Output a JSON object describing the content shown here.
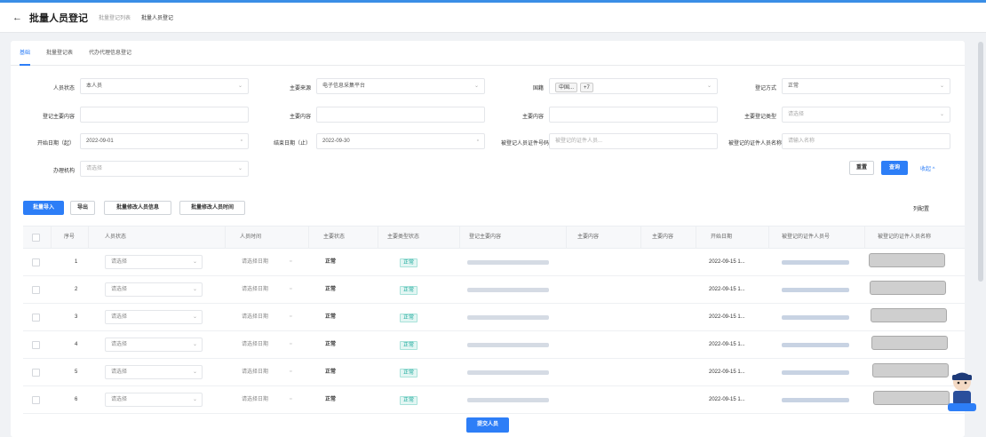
{
  "header": {
    "back_icon": "arrow-left-icon",
    "title": "批量人员登记",
    "breadcrumbs": [
      "批量登记列表",
      "批量人员登记"
    ]
  },
  "tabs": [
    {
      "label": "基础",
      "active": true
    },
    {
      "label": "批量登记表",
      "active": false
    },
    {
      "label": "代办代理信息登记",
      "active": false
    }
  ],
  "form": {
    "f1": {
      "label": "人员状态",
      "value": "本人员",
      "icon": "caret-down-icon"
    },
    "f2": {
      "label": "主要来源",
      "value": "电子信息采集平台",
      "icon": "caret-down-icon"
    },
    "f3": {
      "label": "国籍",
      "chips": [
        "中国...",
        "+7"
      ],
      "icon": "caret-down-icon"
    },
    "f4": {
      "label": "登记方式",
      "value": "正常",
      "icon": "caret-down-icon"
    },
    "f5": {
      "label": "登记主要内容",
      "value": ""
    },
    "f6": {
      "label": "主要内容",
      "value": ""
    },
    "f7": {
      "label": "主要内容",
      "value": ""
    },
    "f8": {
      "label": "主要登记类型",
      "value": "请选择",
      "icon": "caret-down-icon"
    },
    "f9": {
      "label": "开始日期（起）",
      "value": "2022-09-01",
      "icon": "calendar-icon"
    },
    "f10": {
      "label": "结束日期（止）",
      "value": "2022-09-30",
      "icon": "calendar-icon"
    },
    "f11": {
      "label": "被登记人员证件号码",
      "value": "被登记的证件人员..."
    },
    "f12": {
      "label": "被登记的证件人员名称",
      "value": "请输入名称"
    },
    "f13": {
      "label": "办理机构",
      "value": "请选择",
      "icon": "caret-down-icon"
    }
  },
  "filter_actions": {
    "reset": "重置",
    "search": "查询",
    "collapse": "收起 ^"
  },
  "toolbar": {
    "batch_import": "批量导入",
    "export": "导出",
    "batch_edit_person": "批量修改人员信息",
    "batch_edit_time": "批量修改人员时间",
    "column_settings": "列配置"
  },
  "table": {
    "headers": [
      "序号",
      "人员状态",
      "人员时间",
      "主要状态",
      "主要类型状态",
      "登记主要内容",
      "主要内容",
      "主要内容",
      "开始日期",
      "被登记的证件人员号",
      "被登记的证件人员名称"
    ],
    "rows": [
      {
        "no": "1",
        "state": "请选择",
        "time": "请选择日期",
        "status": "正常",
        "tag": "正常",
        "date": "2022-09-15 1..."
      },
      {
        "no": "2",
        "state": "请选择",
        "time": "请选择日期",
        "status": "正常",
        "tag": "正常",
        "date": "2022-09-15 1..."
      },
      {
        "no": "3",
        "state": "请选择",
        "time": "请选择日期",
        "status": "正常",
        "tag": "正常",
        "date": "2022-09-15 1..."
      },
      {
        "no": "4",
        "state": "请选择",
        "time": "请选择日期",
        "status": "正常",
        "tag": "正常",
        "date": "2022-09-15 1..."
      },
      {
        "no": "5",
        "state": "请选择",
        "time": "请选择日期",
        "status": "正常",
        "tag": "正常",
        "date": "2022-09-15 1..."
      },
      {
        "no": "6",
        "state": "请选择",
        "time": "请选择日期",
        "status": "正常",
        "tag": "正常",
        "date": "2022-09-15 1..."
      }
    ]
  },
  "footer": {
    "submit": "提交人员"
  },
  "colors": {
    "accent": "#2d7ef7",
    "tag_green": "#16a89a"
  }
}
